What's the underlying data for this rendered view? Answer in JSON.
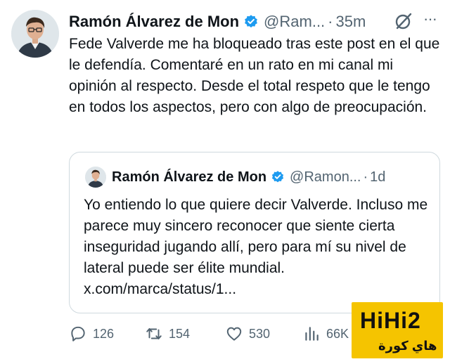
{
  "tweet": {
    "author_name": "Ramón Álvarez de Mon",
    "handle": "@Ram...",
    "separator": "·",
    "time": "35m",
    "more_label": "···",
    "text": "Fede Valverde me ha bloqueado tras este post en el que le defendía. Comentaré en un rato en mi canal mi opinión al respecto. Desde el total respeto que le tengo en todos los aspectos, pero con algo de preocupación.",
    "icons": {
      "verified": "verified-badge-icon",
      "grok": "grok-icon"
    }
  },
  "quoted": {
    "author_name": "Ramón Álvarez de Mon",
    "handle": "@Ramon...",
    "separator": "·",
    "time": "1d",
    "text": "Yo entiendo lo que quiere decir Valverde. Incluso me parece muy sincero reconocer que siente cierta inseguridad jugando allí, pero para mí su nivel de lateral puede ser élite mundial. x.com/marca/status/1..."
  },
  "actions": {
    "replies": "126",
    "retweets": "154",
    "likes": "530",
    "views": "66K"
  },
  "watermark": {
    "logo": "HiHi2",
    "subtitle": "هاي كورة"
  },
  "colors": {
    "verified": "#1d9bf0",
    "secondary_text": "#536471",
    "watermark_bg": "#f5c400"
  }
}
